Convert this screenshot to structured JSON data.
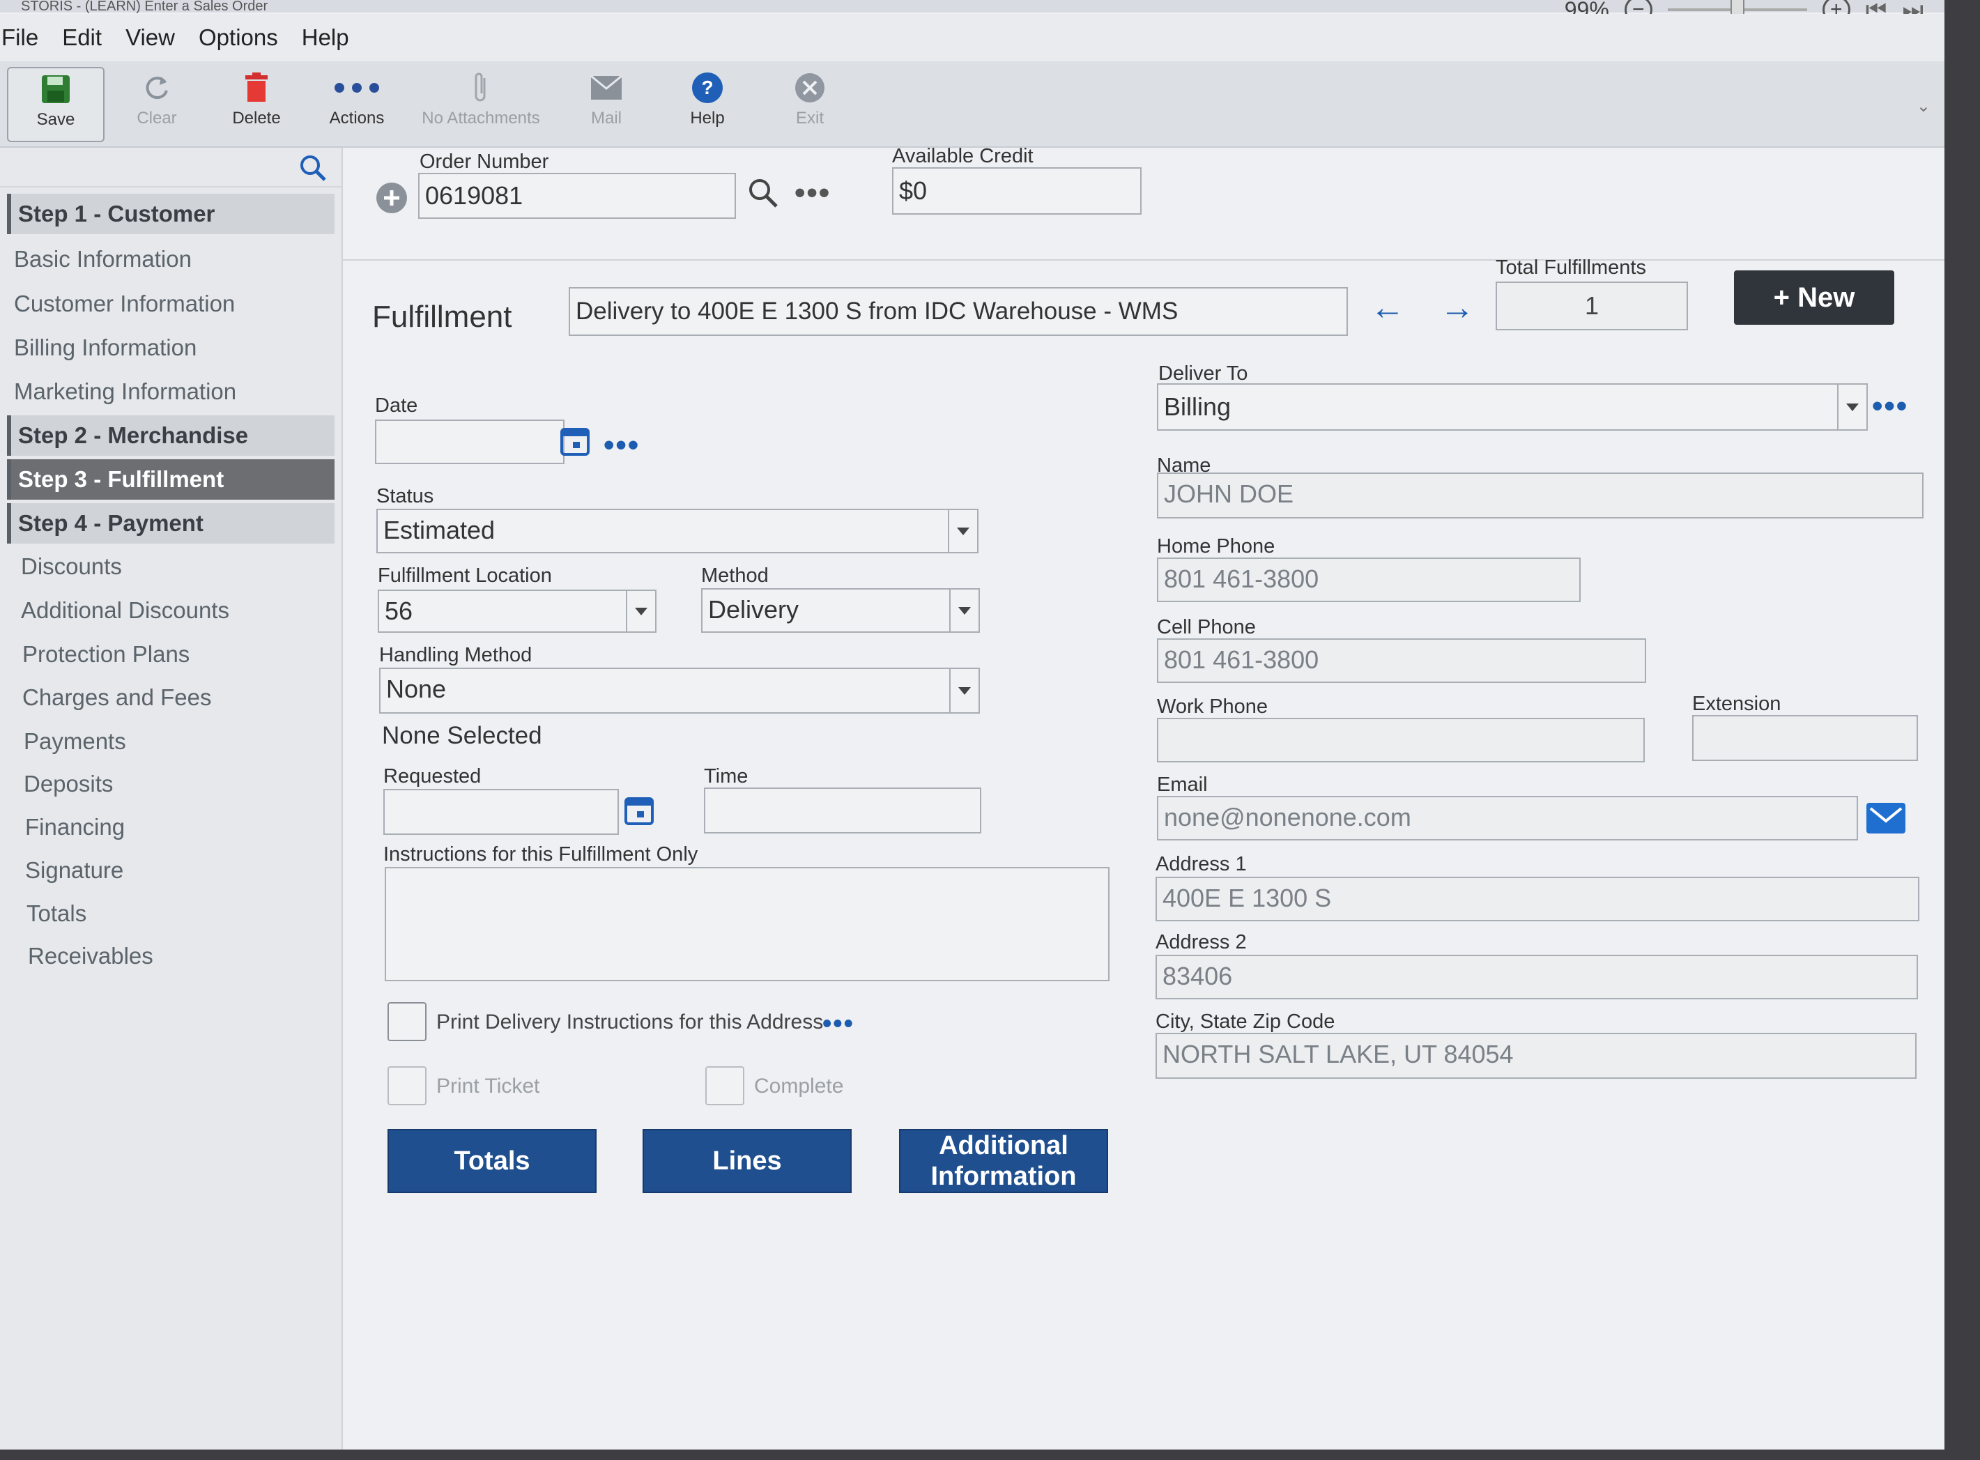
{
  "window": {
    "title": "STORIS - (LEARN) Enter a Sales Order",
    "zoom": "99%"
  },
  "menu": [
    "File",
    "Edit",
    "View",
    "Options",
    "Help"
  ],
  "toolbar": {
    "save": "Save",
    "clear": "Clear",
    "delete": "Delete",
    "actions": "Actions",
    "attachments": "No Attachments",
    "mail": "Mail",
    "help": "Help",
    "exit": "Exit"
  },
  "sidebar": {
    "step1": "Step 1 - Customer",
    "basic": "Basic Information",
    "customer": "Customer Information",
    "billing": "Billing Information",
    "marketing": "Marketing Information",
    "step2": "Step 2 - Merchandise",
    "step3": "Step 3 - Fulfillment",
    "step4": "Step 4 - Payment",
    "discounts": "Discounts",
    "additional_discounts": "Additional Discounts",
    "protection": "Protection Plans",
    "charges": "Charges and Fees",
    "payments": "Payments",
    "deposits": "Deposits",
    "financing": "Financing",
    "signature": "Signature",
    "totals": "Totals",
    "receivables": "Receivables"
  },
  "order": {
    "number_label": "Order Number",
    "number": "0619081",
    "credit_label": "Available Credit",
    "credit": "$0"
  },
  "fulfillment": {
    "title": "Fulfillment",
    "description": "Delivery to 400E E 1300 S from IDC Warehouse - WMS",
    "total_label": "Total Fulfillments",
    "total": "1",
    "new_label": "+ New",
    "date_label": "Date",
    "date": "",
    "status_label": "Status",
    "status": "Estimated",
    "location_label": "Fulfillment Location",
    "location": "56",
    "method_label": "Method",
    "method": "Delivery",
    "handling_label": "Handling Method",
    "handling": "None",
    "none_selected": "None Selected",
    "requested_label": "Requested",
    "requested": "",
    "time_label": "Time",
    "time": "",
    "instructions_label": "Instructions for this Fulfillment Only",
    "print_delivery_label": "Print Delivery Instructions for this Address",
    "print_ticket_label": "Print Ticket",
    "complete_label": "Complete",
    "btn_totals": "Totals",
    "btn_lines": "Lines",
    "btn_additional": "Additional Information"
  },
  "deliver": {
    "to_label": "Deliver To",
    "to": "Billing",
    "name_label": "Name",
    "name": "JOHN DOE",
    "home_label": "Home Phone",
    "home": "801 461-3800",
    "cell_label": "Cell Phone",
    "cell": "801 461-3800",
    "work_label": "Work Phone",
    "work": "",
    "ext_label": "Extension",
    "ext": "",
    "email_label": "Email",
    "email": "none@nonenone.com",
    "addr1_label": "Address 1",
    "addr1": "400E E 1300 S",
    "addr2_label": "Address 2",
    "addr2": "83406",
    "city_label": "City, State Zip Code",
    "city": "NORTH SALT LAKE, UT 84054"
  },
  "colors": {
    "accent": "#1f4f8f",
    "link": "#1d5db0",
    "active_step": "#6c6e72"
  }
}
